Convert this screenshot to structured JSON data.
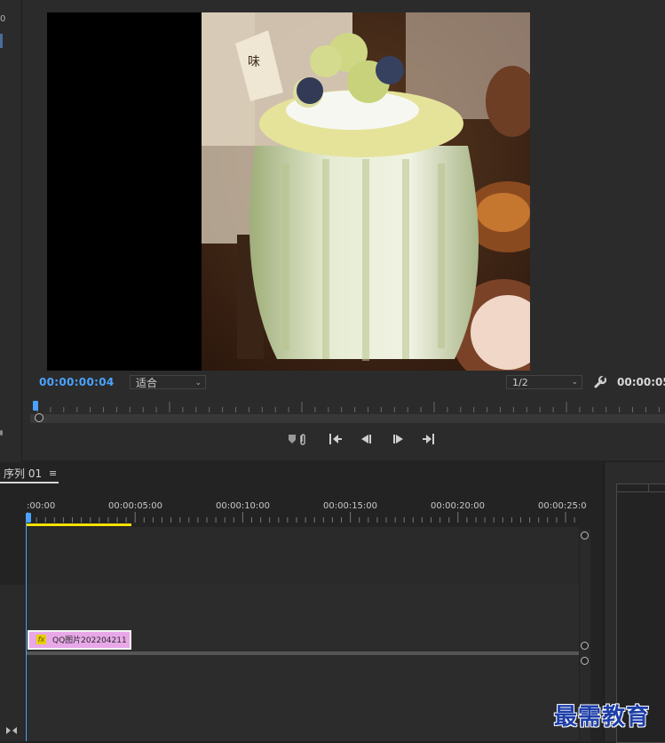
{
  "left_strip": {
    "number": "0"
  },
  "monitor": {
    "timecode_current": "00:00:00:04",
    "fit_value": "适合",
    "resolution_value": "1/2",
    "timecode_duration": "00:00:05"
  },
  "timeline": {
    "sequence_name": "序列 01",
    "menu_glyph": "≡",
    "ruler_labels": [
      ":00:00",
      "00:00:05:00",
      "00:00:10:00",
      "00:00:15:00",
      "00:00:20:00",
      "00:00:25:0"
    ],
    "clip": {
      "fx_label": "fx",
      "name": "QQ图片202204211"
    }
  },
  "watermark": "最需教育",
  "icons": {
    "chevron": "chevron-down-icon",
    "wrench": "wrench-icon",
    "marker": "add-marker-icon",
    "step_start": "go-to-in-icon",
    "step_back": "step-back-icon",
    "step_forward": "step-forward-icon",
    "step_end": "go-to-out-icon"
  },
  "colors": {
    "accent_blue": "#4aa3ff",
    "work_area_yellow": "#f5e100",
    "clip_pink": "#e8a8e8"
  }
}
